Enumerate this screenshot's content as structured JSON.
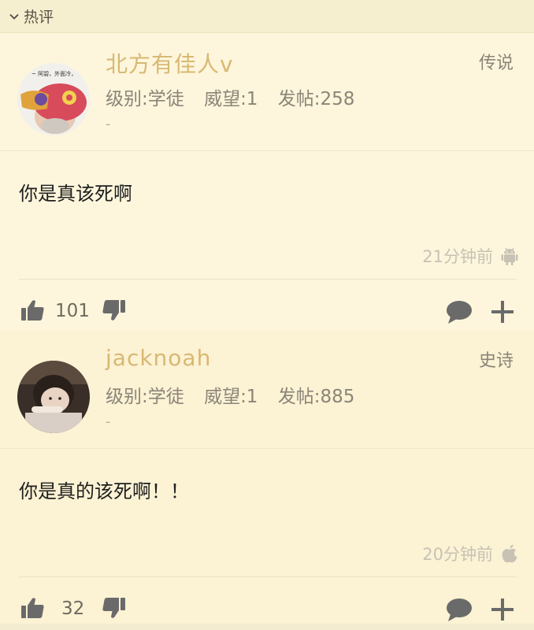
{
  "section": {
    "title": "热评"
  },
  "comments": [
    {
      "username": "北方有佳人v",
      "rank": "传说",
      "stats": {
        "level": "级别:学徒",
        "prestige": "威望:1",
        "posts": "发帖:258"
      },
      "sub": "-",
      "content": "你是真该死啊",
      "time": "21分钟前",
      "platform_icon": "android-icon",
      "likes": "101"
    },
    {
      "username": "jacknoah",
      "rank": "史诗",
      "stats": {
        "level": "级别:学徒",
        "prestige": "威望:1",
        "posts": "发帖:885"
      },
      "sub": "-",
      "content": "你是真的该死啊！！",
      "time": "20分钟前",
      "platform_icon": "apple-icon",
      "likes": "32"
    }
  ],
  "colors": {
    "username": "#d8b873",
    "background": "#fbf4d9",
    "icon": "#6a6a6a"
  }
}
